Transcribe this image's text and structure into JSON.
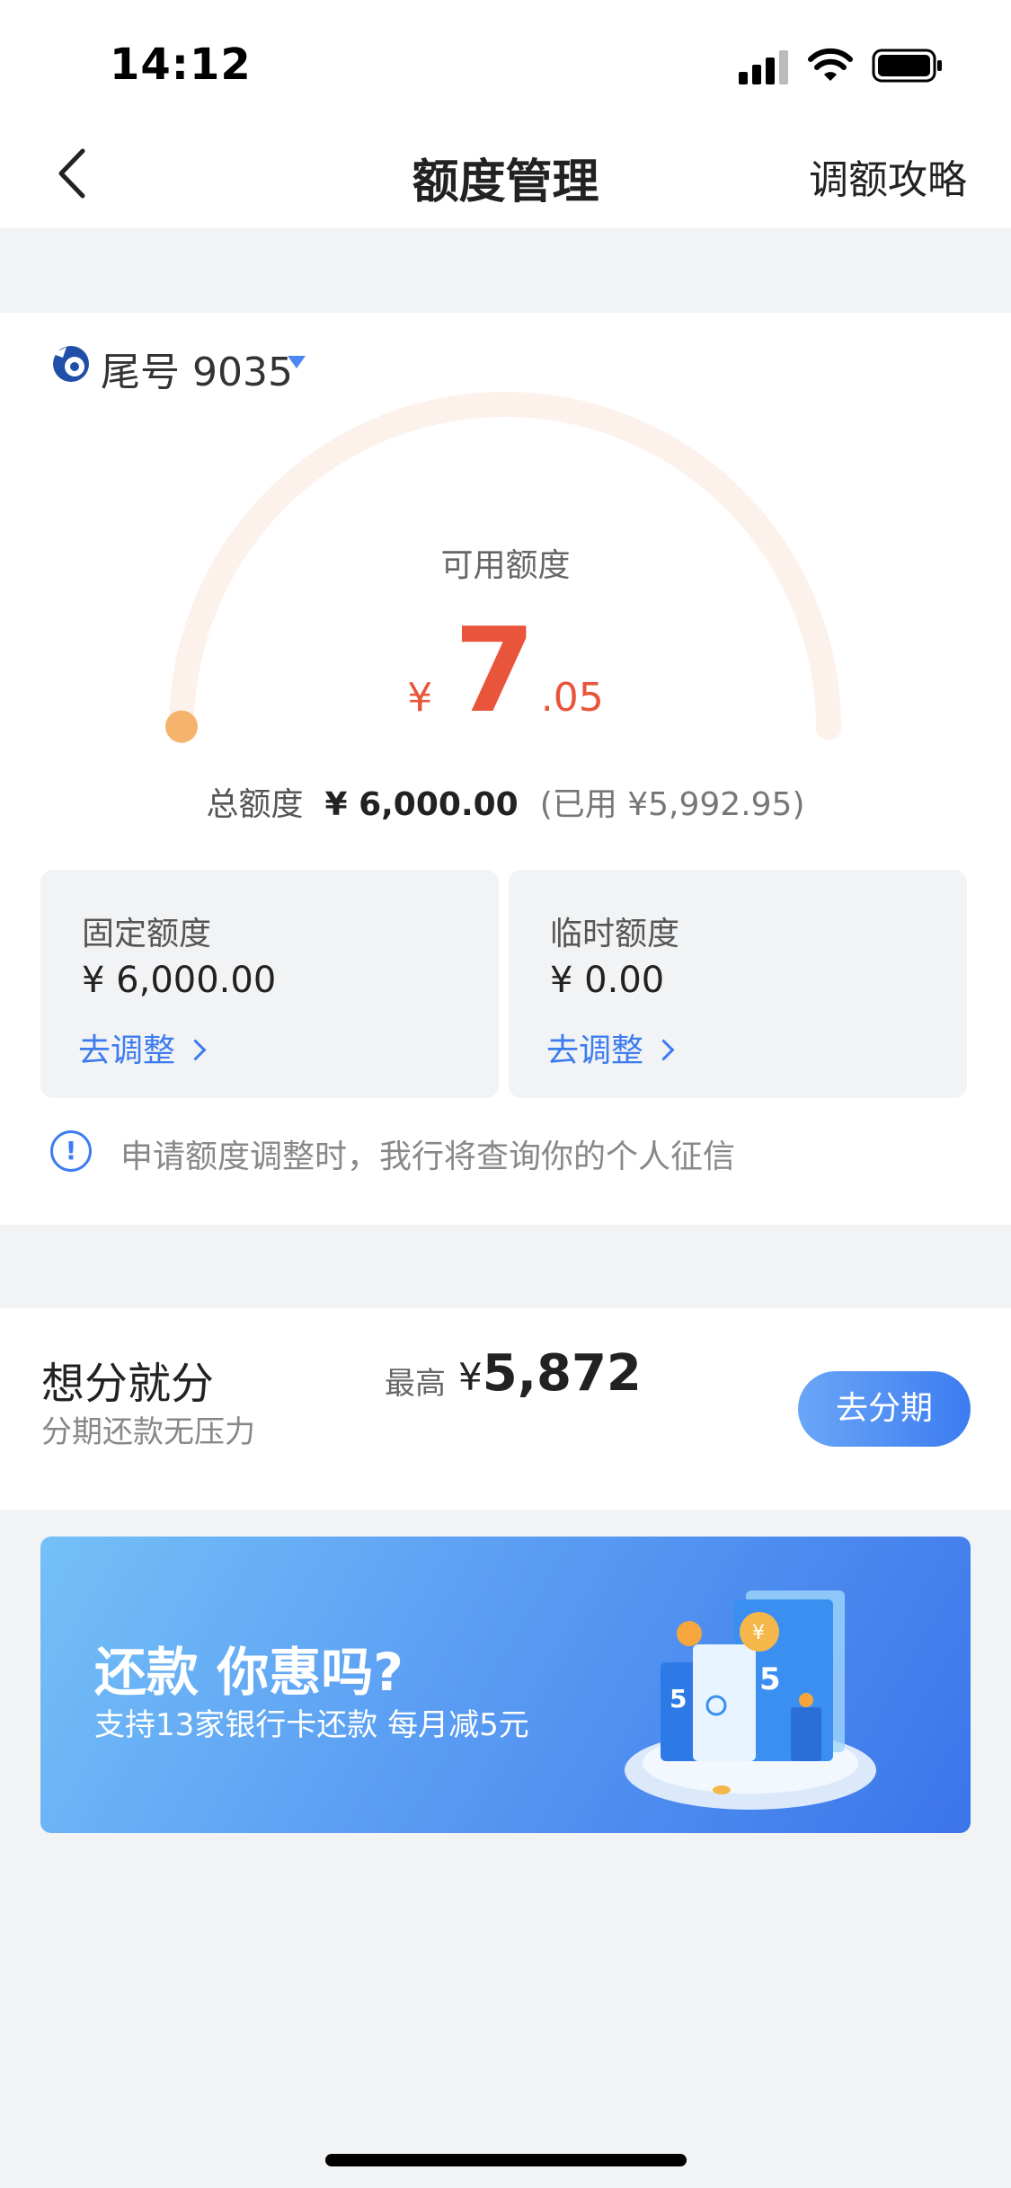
{
  "status": {
    "time": "14:12"
  },
  "nav": {
    "title": "额度管理",
    "right_link": "调额攻略"
  },
  "card": {
    "tail_label": "尾号 9035",
    "available_label": "可用额度",
    "available": {
      "currency": "¥",
      "integer": "7",
      "decimal": ".05"
    },
    "gauge_fill_fraction": 0.0012,
    "total_label": "总额度",
    "total_value": "¥ 6,000.00",
    "used_text": "(已用 ¥5,992.95)",
    "quota_boxes": [
      {
        "title": "固定额度",
        "value": "¥ 6,000.00",
        "link": "去调整"
      },
      {
        "title": "临时额度",
        "value": "¥ 0.00",
        "link": "去调整"
      }
    ],
    "notice": "申请额度调整时，我行将查询你的个人征信"
  },
  "installment": {
    "title": "想分就分",
    "subtitle": "分期还款无压力",
    "max_label": "最高",
    "max_currency": "¥",
    "max_value": "5,872",
    "button": "去分期"
  },
  "banner": {
    "title": "还款 你惠吗?",
    "subtitle": "支持13家银行卡还款 每月减5元"
  },
  "colors": {
    "accent_blue": "#3d7cf0",
    "amount_red": "#e8553a",
    "gauge_track": "#fdf1ec",
    "gauge_dot": "#f5b36b"
  }
}
